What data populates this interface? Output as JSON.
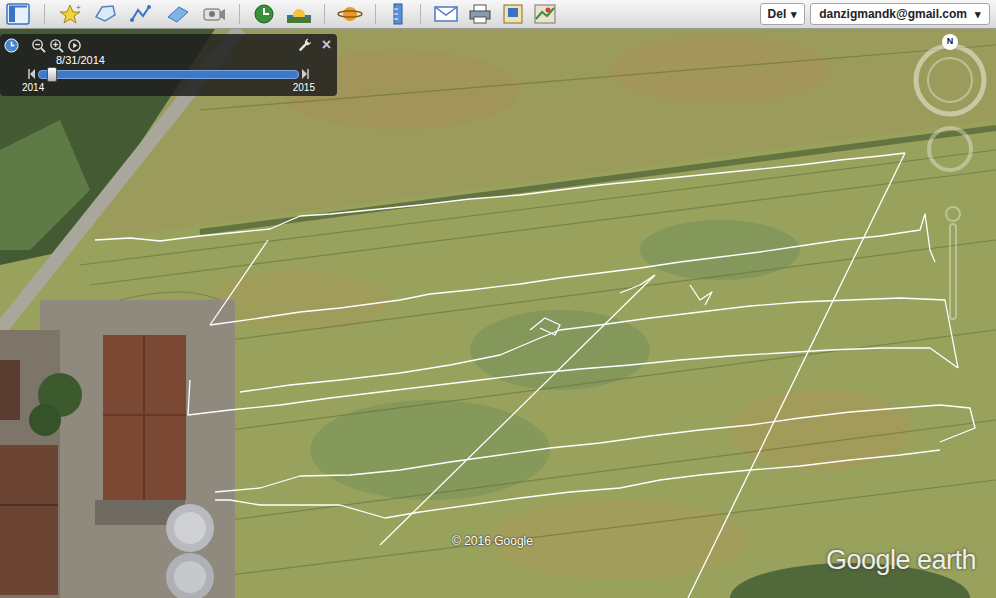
{
  "toolbar": {
    "language": {
      "label": "Del",
      "arrow": "▾"
    },
    "account": {
      "label": "danzigmandk@gmail.com",
      "arrow": "▾"
    }
  },
  "time_slider": {
    "date": "8/31/2014",
    "start": "2014",
    "end": "2015",
    "level": 0.05,
    "close": "×"
  },
  "navigation": {
    "compass": "N"
  },
  "map": {
    "copyright": "© 2016 Google",
    "logo": "Google earth"
  }
}
